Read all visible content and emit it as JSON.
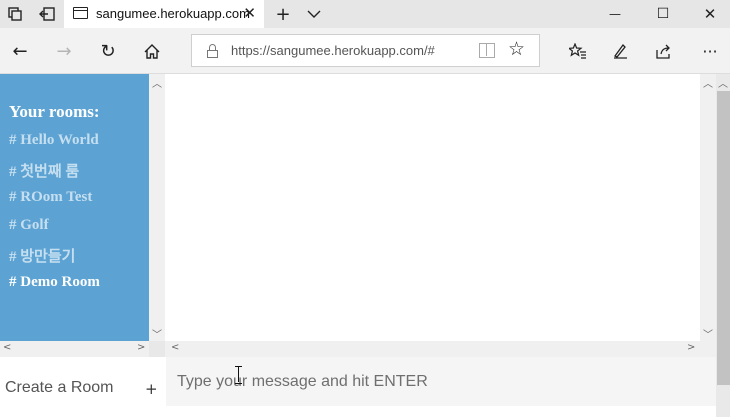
{
  "browser": {
    "tab_title": "sangumee.herokuapp.com",
    "url": "https://sangumee.herokuapp.com/#",
    "icons": {
      "tab_switch": "tab-stack-icon",
      "tab_back": "tab-aside-icon",
      "new_tab": "+",
      "tab_list": "chevron-down-icon",
      "minimize": "—",
      "maximize": "☐",
      "close": "✕",
      "back": "←",
      "forward": "→",
      "refresh": "↻",
      "home": "⌂",
      "favorite": "☆",
      "favorites_list": "☆≡",
      "pen": "✒",
      "share": "⇪",
      "more": "···"
    }
  },
  "sidebar": {
    "heading": "Your rooms:",
    "rooms": [
      {
        "label": "# Hello World",
        "active": false
      },
      {
        "label": "# 첫번째 룸",
        "active": false
      },
      {
        "label": "# ROom Test",
        "active": false
      },
      {
        "label": "# Golf",
        "active": false
      },
      {
        "label": "# 방만들기",
        "active": false
      },
      {
        "label": "# Demo Room",
        "active": true
      }
    ]
  },
  "create_room": {
    "label": "Create a Room",
    "button": "+"
  },
  "message_input": {
    "placeholder": "Type your message and hit ENTER",
    "value": ""
  },
  "colors": {
    "sidebar_bg": "#5ca3d3",
    "room_inactive": "#c6dff0",
    "room_active": "#ffffff"
  }
}
